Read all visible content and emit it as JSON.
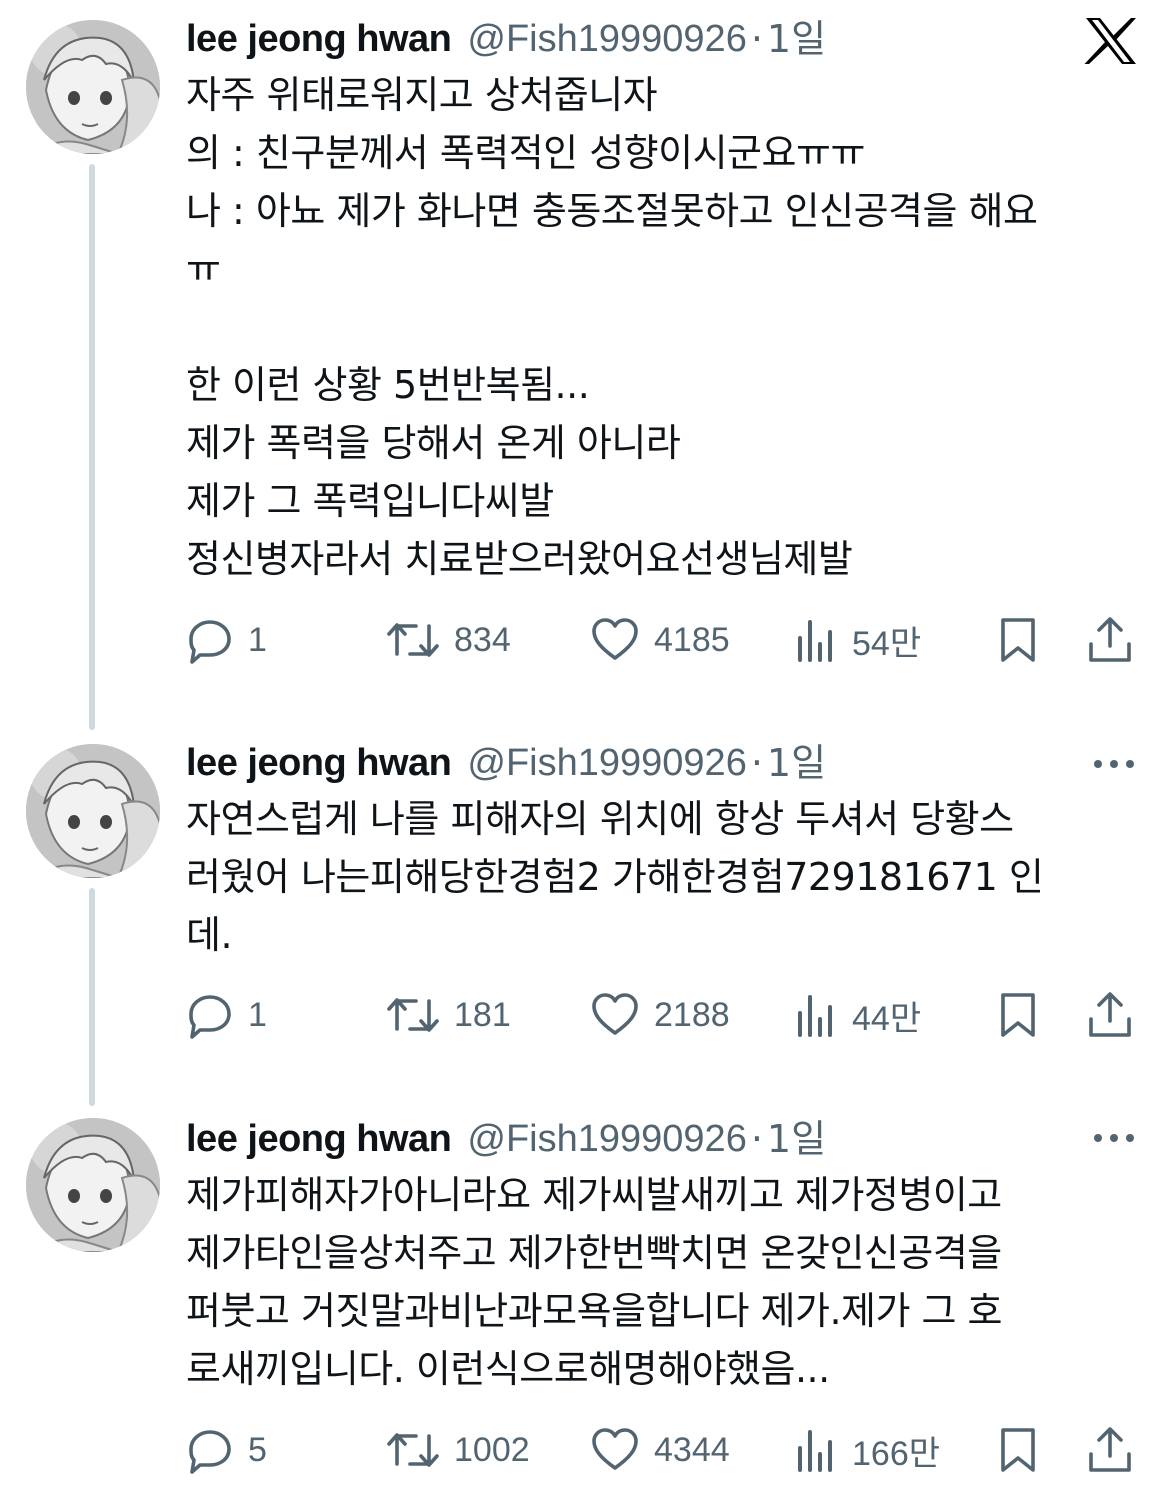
{
  "brand_icon": "x-logo-icon",
  "tweets": [
    {
      "name": "lee jeong hwan",
      "handle": "@Fish19990926",
      "separator": "·",
      "time": "1일",
      "text": "자주 위태로워지고 상처줍니자\n의 : 친구분께서 폭력적인 성향이시군요ㅠㅠ\n나 : 아뇨 제가 화나면 충동조절못하고 인신공격을 해요\nㅠ\n\n한 이런 상황 5번반복됨...\n제가 폭력을 당해서 온게 아니라\n제가 그 폭력입니다씨발\n정신병자라서 치료받으러왔어요선생님제발",
      "replies": "1",
      "retweets": "834",
      "likes": "4185",
      "views": "54만"
    },
    {
      "name": "lee jeong hwan",
      "handle": "@Fish19990926",
      "separator": "·",
      "time": "1일",
      "text": "자연스럽게 나를 피해자의 위치에 항상 두셔서 당황스\n러웠어 나는피해당한경험2 가해한경험729181671 인\n데.",
      "replies": "1",
      "retweets": "181",
      "likes": "2188",
      "views": "44만"
    },
    {
      "name": "lee jeong hwan",
      "handle": "@Fish19990926",
      "separator": "·",
      "time": "1일",
      "text": "제가피해자가아니라요 제가씨발새끼고 제가정병이고\n제가타인을상처주고 제가한번빡치면 온갖인신공격을\n퍼붓고 거짓말과비난과모욕을합니다 제가.제가 그 호\n로새끼입니다. 이런식으로해명해야했음...",
      "replies": "5",
      "retweets": "1002",
      "likes": "4344",
      "views": "166만"
    }
  ],
  "icons": {
    "reply": "reply-icon",
    "retweet": "retweet-icon",
    "like": "heart-icon",
    "views": "views-icon",
    "bookmark": "bookmark-icon",
    "share": "share-icon",
    "more": "more-icon"
  },
  "colors": {
    "text": "#0f1419",
    "secondary": "#536471",
    "thread_line": "#cfd9de"
  }
}
